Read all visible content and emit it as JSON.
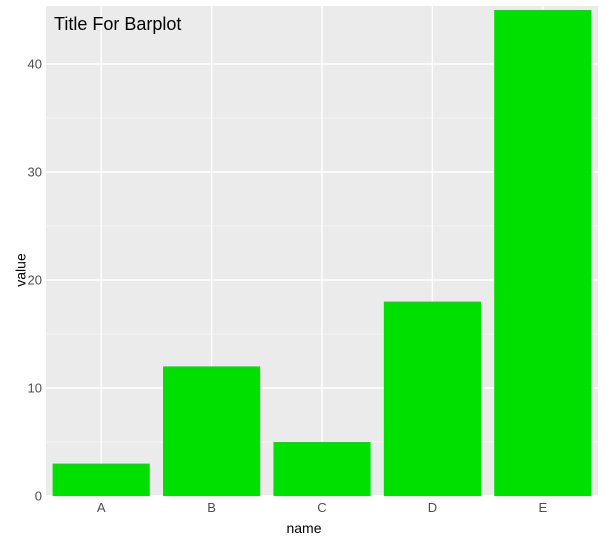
{
  "chart_data": {
    "type": "bar",
    "title": "Title For Barplot",
    "xlabel": "name",
    "ylabel": "value",
    "categories": [
      "A",
      "B",
      "C",
      "D",
      "E"
    ],
    "values": [
      3,
      12,
      5,
      18,
      45
    ],
    "ylim": [
      0,
      45
    ],
    "yticks": [
      0,
      10,
      20,
      30,
      40
    ],
    "bar_color": "#00e000",
    "panel_bg": "#ebebeb",
    "grid_color": "#ffffff"
  }
}
